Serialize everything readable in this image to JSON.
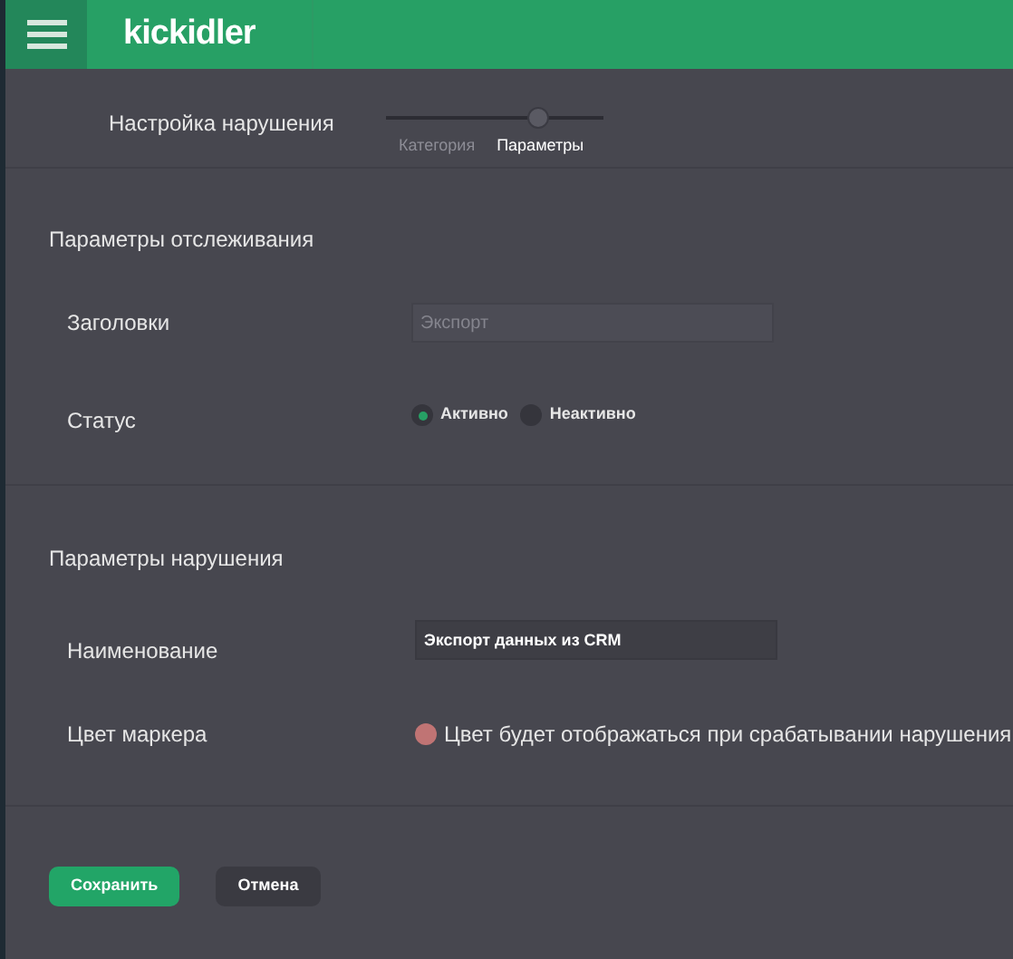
{
  "header": {
    "logo": "kickidler"
  },
  "wizard": {
    "title": "Настройка нарушения",
    "steps": [
      {
        "label": "Категория",
        "selected": false
      },
      {
        "label": "Параметры",
        "selected": true
      }
    ]
  },
  "tracking": {
    "heading": "Параметры отслеживания",
    "headers_label": "Заголовки",
    "headers_field": {
      "placeholder": "Экспорт"
    },
    "status_label": "Статус",
    "status_options": [
      {
        "label": "Активно",
        "selected": true
      },
      {
        "label": "Неактивно",
        "selected": false
      }
    ]
  },
  "violation": {
    "heading": "Параметры нарушения",
    "name_label": "Наименование",
    "name_field": {
      "value": "Экспорт данных из CRM"
    },
    "marker_label": "Цвет маркера",
    "marker": {
      "color": "#c07474",
      "hint": "Цвет будет отображаться при срабатывании нарушения"
    }
  },
  "buttons": [
    {
      "label": "Сохранить",
      "kind": "primary"
    },
    {
      "label": "Отмена",
      "kind": "secondary"
    }
  ]
}
